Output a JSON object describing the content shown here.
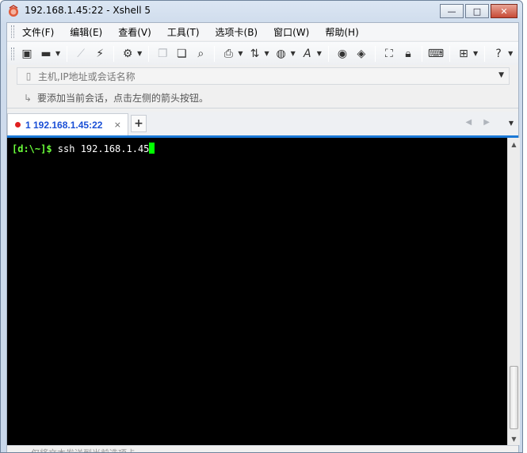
{
  "window": {
    "title": "192.168.1.45:22 - Xshell 5",
    "minimize_glyph": "—",
    "maximize_glyph": "□",
    "close_glyph": "✕"
  },
  "menu": {
    "items": [
      {
        "label": "文件(F)"
      },
      {
        "label": "编辑(E)"
      },
      {
        "label": "查看(V)"
      },
      {
        "label": "工具(T)"
      },
      {
        "label": "选项卡(B)"
      },
      {
        "label": "窗口(W)"
      },
      {
        "label": "帮助(H)"
      }
    ]
  },
  "toolbar": {
    "icons": [
      "new-session-icon",
      "open-folder-icon",
      "disconnect-icon",
      "reconnect-icon",
      "properties-icon",
      "copy-icon",
      "paste-icon",
      "find-icon",
      "print-icon",
      "transfer-icon",
      "globe-icon",
      "font-icon",
      "xftp-icon",
      "xmanager-icon",
      "fullscreen-icon",
      "lock-icon",
      "keyboard-icon",
      "new-tab-icon",
      "help-icon"
    ]
  },
  "address": {
    "placeholder": "主机,IP地址或会话名称"
  },
  "hint": {
    "text": "要添加当前会话，点击左侧的箭头按钮。"
  },
  "tabs": {
    "active": {
      "label": "1 192.168.1.45:22",
      "close_glyph": "×"
    },
    "new_tab_glyph": "+",
    "nav_glyphs": "◀ ▶",
    "menu_glyph": "▼"
  },
  "terminal": {
    "prompt": "[d:\\~]$",
    "command": " ssh 192.168.1.45"
  },
  "colors": {
    "prompt": "#6bff3a",
    "cursor": "#00ff00",
    "terminal_bg": "#000000",
    "tab_label": "#1a4fd6",
    "tab_accent": "#1a78d6",
    "status_dot": "#e02020"
  },
  "status": {
    "text": "仅将文本发送到当前选项卡"
  }
}
